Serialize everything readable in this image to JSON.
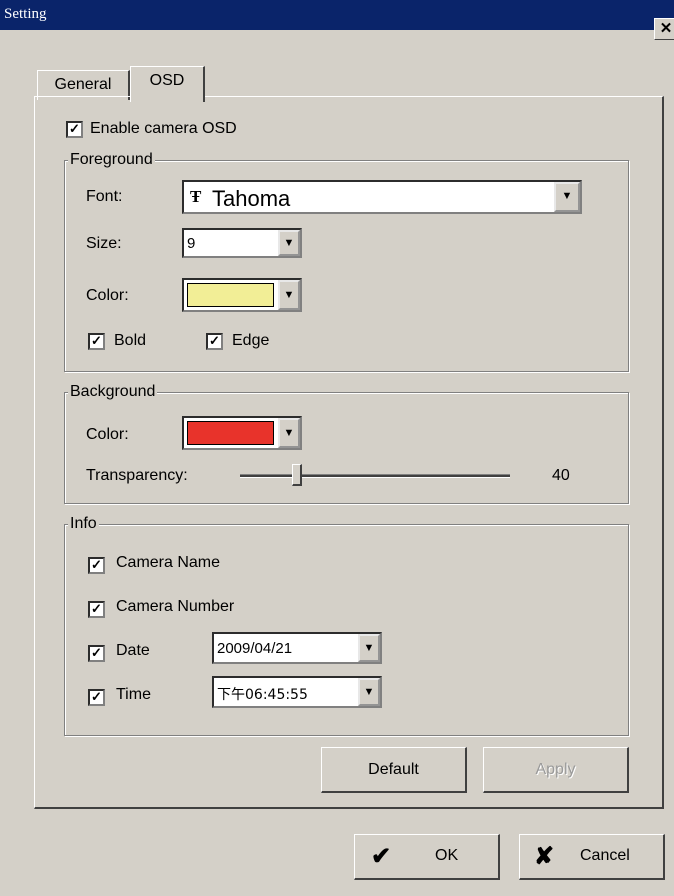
{
  "window": {
    "title": "Setting",
    "close_glyph": "✕"
  },
  "tabs": [
    {
      "label": "General",
      "active": false
    },
    {
      "label": "OSD",
      "active": true
    }
  ],
  "enable_osd": {
    "label": "Enable camera OSD",
    "checked": true
  },
  "foreground": {
    "legend": "Foreground",
    "font_label": "Font:",
    "font_value": "Tahoma",
    "font_icon": "truetype-font-icon",
    "size_label": "Size:",
    "size_value": "9",
    "color_label": "Color:",
    "color_value": "#f2ee96",
    "bold": {
      "label": "Bold",
      "checked": true
    },
    "edge": {
      "label": "Edge",
      "checked": true
    }
  },
  "background": {
    "legend": "Background",
    "color_label": "Color:",
    "color_value": "#e8332b",
    "transparency_label": "Transparency:",
    "transparency_value": "40",
    "transparency_fraction": 0.2
  },
  "info": {
    "legend": "Info",
    "camera_name": {
      "label": "Camera Name",
      "checked": true
    },
    "camera_number": {
      "label": "Camera Number",
      "checked": true
    },
    "date": {
      "label": "Date",
      "checked": true,
      "value": "2009/04/21"
    },
    "time": {
      "label": "Time",
      "checked": true,
      "value": "下午06:45:55"
    }
  },
  "buttons": {
    "default": "Default",
    "apply": "Apply",
    "ok": "OK",
    "cancel": "Cancel"
  }
}
